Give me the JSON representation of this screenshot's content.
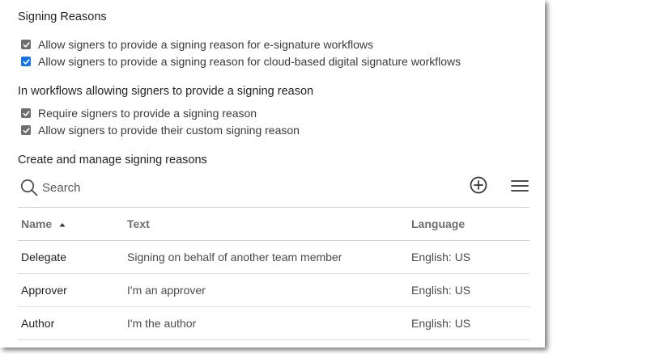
{
  "colors": {
    "checkbox_gray": "#6e6e6e",
    "checkbox_blue": "#1473e6"
  },
  "signing_reasons": {
    "title": "Signing Reasons",
    "options": [
      {
        "label": "Allow signers to provide a signing reason for e-signature workflows",
        "checked": true,
        "accent": "gray"
      },
      {
        "label": "Allow signers to provide a signing reason for cloud-based digital signature workflows",
        "checked": true,
        "accent": "blue"
      }
    ]
  },
  "workflows": {
    "title": "In workflows allowing signers to provide a signing reason",
    "options": [
      {
        "label": "Require signers to provide a signing reason",
        "checked": true,
        "accent": "gray"
      },
      {
        "label": "Allow signers to provide their custom signing reason",
        "checked": true,
        "accent": "gray"
      }
    ]
  },
  "manage": {
    "title": "Create and manage signing reasons",
    "search": {
      "placeholder": "Search",
      "icon": "search-icon"
    },
    "add_icon": "plus-circle-icon",
    "menu_icon": "hamburger-menu-icon"
  },
  "table": {
    "headers": {
      "name": "Name",
      "text": "Text",
      "language": "Language"
    },
    "sort": {
      "column": "name",
      "direction": "ascending"
    },
    "rows": [
      {
        "name": "Delegate",
        "text": "Signing on behalf of another team member",
        "language": "English: US"
      },
      {
        "name": "Approver",
        "text": "I'm an approver",
        "language": "English: US"
      },
      {
        "name": "Author",
        "text": "I'm the author",
        "language": "English: US"
      }
    ]
  }
}
